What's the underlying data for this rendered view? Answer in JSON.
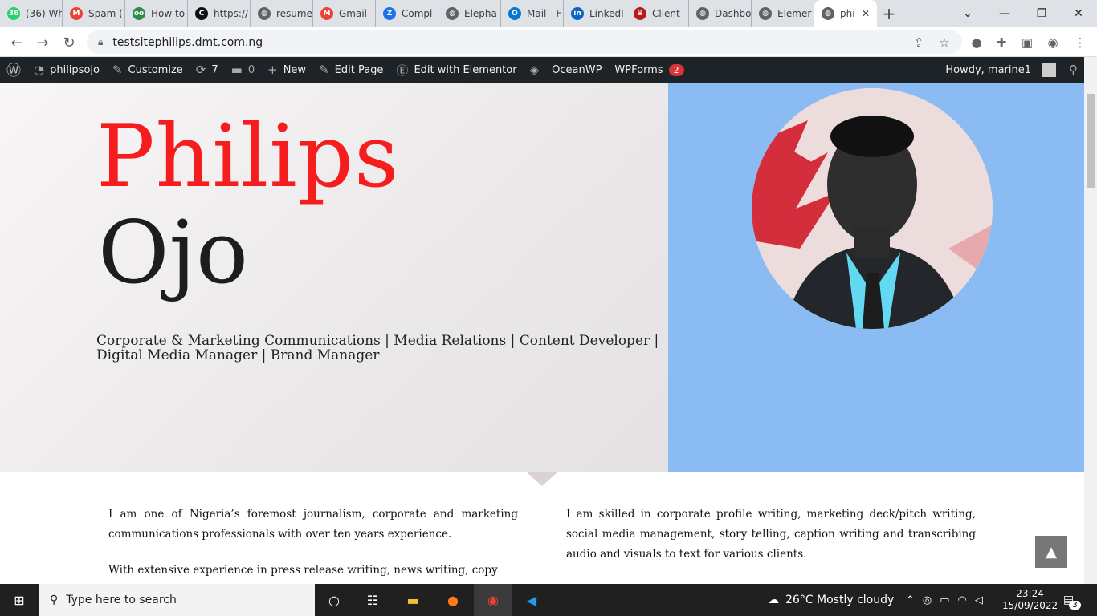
{
  "tabs": [
    {
      "label": "(36) Wh",
      "fav": "36",
      "color": "#25d366",
      "icon": "whatsapp-icon"
    },
    {
      "label": "Spam (",
      "fav": "M",
      "color": "#ea4335",
      "icon": "gmail-icon"
    },
    {
      "label": "How to",
      "fav": "oo",
      "color": "#2f8d46",
      "icon": "geeksforgeeks-icon"
    },
    {
      "label": "https://",
      "fav": "C",
      "color": "#111111",
      "icon": "chatgpt-icon"
    },
    {
      "label": "resume",
      "fav": "◍",
      "color": "#5f6368",
      "icon": "globe-icon"
    },
    {
      "label": "Gmail",
      "fav": "M",
      "color": "#ea4335",
      "icon": "gmail-icon"
    },
    {
      "label": "Compl",
      "fav": "Z",
      "color": "#1a73e8",
      "icon": "zotero-icon"
    },
    {
      "label": "Elepha",
      "fav": "◍",
      "color": "#5f6368",
      "icon": "globe-icon"
    },
    {
      "label": "Mail - F",
      "fav": "O",
      "color": "#0078d4",
      "icon": "outlook-icon"
    },
    {
      "label": "LinkedI",
      "fav": "in",
      "color": "#0a66c2",
      "icon": "linkedin-icon"
    },
    {
      "label": "Client",
      "fav": "♛",
      "color": "#b71c1c",
      "icon": "crown-icon"
    },
    {
      "label": "Dashbo",
      "fav": "◍",
      "color": "#5f6368",
      "icon": "globe-icon"
    },
    {
      "label": "Elemer",
      "fav": "◍",
      "color": "#5f6368",
      "icon": "globe-icon"
    },
    {
      "label": "phi",
      "fav": "◍",
      "color": "#5f6368",
      "icon": "globe-icon",
      "active": true
    }
  ],
  "browser": {
    "url": "testsitephilips.dmt.com.ng",
    "new_tab": "+",
    "minimize": "⌄",
    "restore": "—",
    "maximize": "❐",
    "close": "✕"
  },
  "wpbar": {
    "site": "philipsojo",
    "customize": "Customize",
    "updates": "7",
    "comments": "0",
    "new": "New",
    "edit_page": "Edit Page",
    "elementor": "Edit with Elementor",
    "oceanwp": "OceanWP",
    "wpforms": "WPForms",
    "wpforms_count": "2",
    "howdy": "Howdy, marine1"
  },
  "hero": {
    "first_name": "Philips",
    "last_name": "Ojo",
    "tagline": "Corporate & Marketing Communications | Media Relations | Content Developer | Digital Media Manager | Brand Manager"
  },
  "about": {
    "left": [
      "I am one of Nigeria’s foremost journalism, corporate and marketing communications professionals with over ten years experience.",
      "With extensive experience in press release writing, news writing, copy"
    ],
    "right": [
      "I am skilled in corporate profile writing, marketing deck/pitch writing, social media management, story telling, caption writing and transcribing audio and visuals to text for various clients."
    ]
  },
  "taskbar": {
    "search_placeholder": "Type here to search",
    "weather": "26°C  Mostly cloudy",
    "time": "23:24",
    "date": "15/09/2022",
    "notifications": "3"
  },
  "colors": {
    "accent_red": "#f51d1d",
    "hero_blue": "#8abbf2",
    "wp_bar": "#1d2327"
  }
}
